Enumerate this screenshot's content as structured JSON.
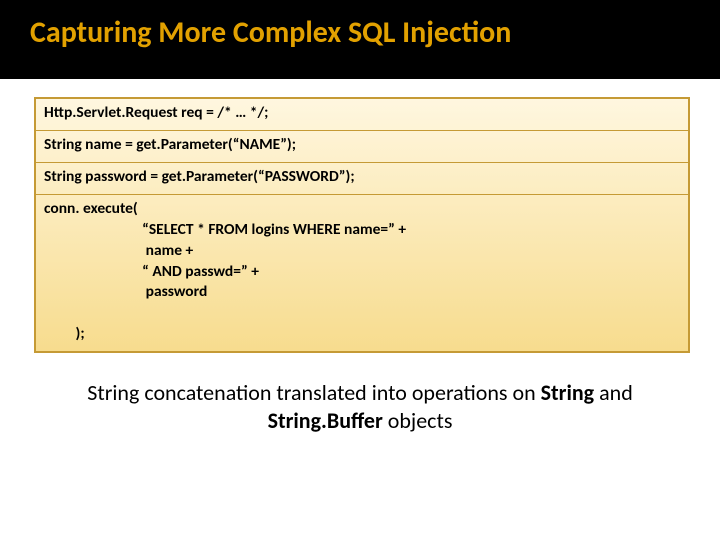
{
  "title": "Capturing More Complex SQL Injection",
  "code": {
    "line1": "Http.Servlet.Request req = /* … */;",
    "line2": "String name = get.Parameter(“NAME”);",
    "line3": "String password = get.Parameter(“PASSWORD”);",
    "line4": "conn. execute(\n                            “SELECT * FROM logins WHERE name=” +\n                             name +\n                            “ AND passwd=” +\n                             password\n\n         );"
  },
  "footer": {
    "part1": "String concatenation translated into operations on ",
    "bold1": "String",
    "part2": " and ",
    "bold2": "String.Buffer",
    "part3": " objects"
  }
}
